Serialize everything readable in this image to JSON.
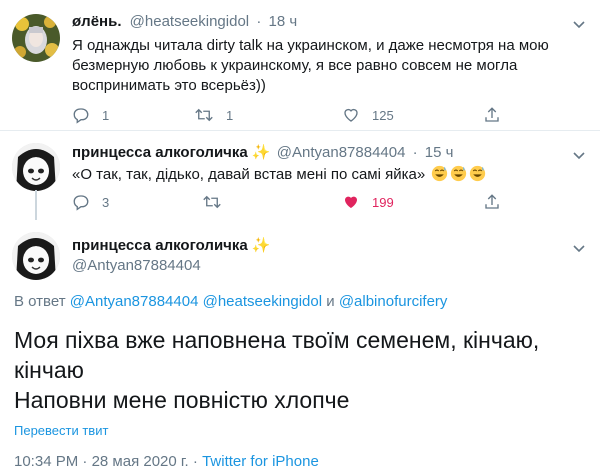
{
  "tweet1": {
    "name": "øлёнь.",
    "handle": "@heatseekingidol",
    "sep": "·",
    "time": "18 ч",
    "text": "Я однажды читала dirty talk на украинском, и даже несмотря на мою безмерную любовь к украинскому, я все равно совсем не могла воспринимать это всерьёз))",
    "reply_count": "1",
    "retweet_count": "1",
    "like_count": "125",
    "icons": [
      "reply-icon",
      "retweet-icon",
      "heart-icon",
      "share-icon"
    ]
  },
  "tweet2": {
    "name": "принцесса алкоголичка",
    "handle": "@Antyan87884404",
    "sep": "·",
    "time": "15 ч",
    "text": "«О так, так, дідько, давай встав мені по самі яйка»",
    "reply_count": "3",
    "like_count": "199",
    "liked_color": "#e0245e",
    "icons": [
      "reply-icon",
      "retweet-icon",
      "heart-filled-icon",
      "share-icon",
      "sparkles-icon",
      "sweat-smile-emoji"
    ]
  },
  "main": {
    "name": "принцесса алкоголичка",
    "handle": "@Antyan87884404",
    "reply_prefix": "В ответ",
    "reply_user1": "@Antyan87884404",
    "reply_user2": "@heatseekingidol",
    "reply_and": "и",
    "reply_user3": "@albinofurcifery",
    "text_line1": "Моя піхва вже наповнена твоїм семенем, кінчаю,",
    "text_line2": "кінчаю",
    "text_line3": "Наповни мене повністю хлопче",
    "translate": "Перевести твит",
    "time": "10:34 PM",
    "date": "28 мая 2020 г.",
    "source": "Twitter for iPhone",
    "sep": "·"
  },
  "colors": {
    "link": "#1b95e0",
    "muted": "#657786",
    "border": "#e6ecf0",
    "like": "#e0245e"
  }
}
